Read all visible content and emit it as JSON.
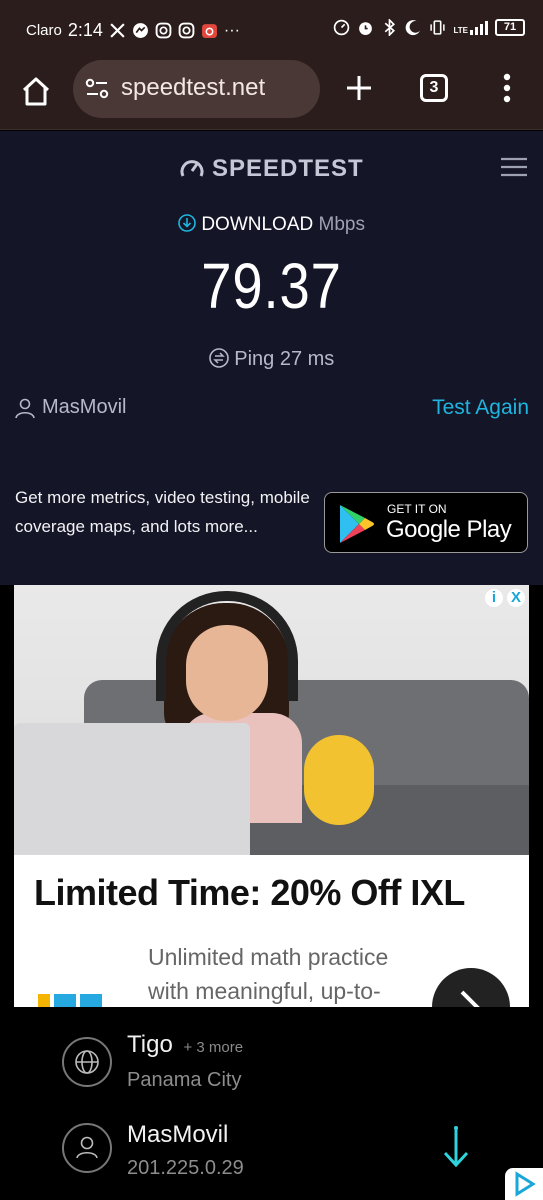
{
  "status_bar": {
    "carrier": "Claro",
    "time": "2:14",
    "overflow": "···",
    "network": "LTE",
    "battery": "71"
  },
  "browser": {
    "url": "speedtest.net",
    "tab_count": "3"
  },
  "speedtest": {
    "logo_text": "SPEEDTEST",
    "download_label": "DOWNLOAD",
    "download_unit": "Mbps",
    "download_value": "79.37",
    "ping_label": "Ping",
    "ping_value": "27",
    "ping_unit": "ms",
    "isp": "MasMovil",
    "test_again": "Test Again",
    "promo_text": "Get more metrics, video testing, mobile coverage maps, and lots more...",
    "store_small": "GET IT ON",
    "store_big": "Google Play"
  },
  "ad": {
    "title": "Limited Time: 20% Off IXL",
    "description": "Unlimited math practice with meaningful, up-to-",
    "logo": "IXL",
    "info_glyph": "i",
    "close_glyph": "X"
  },
  "servers": [
    {
      "name": "Tigo",
      "more": "+ 3 more",
      "location": "Panama City",
      "icon": "globe-icon"
    },
    {
      "name": "MasMovil",
      "more": "",
      "location": "201.225.0.29",
      "icon": "person-icon"
    }
  ],
  "colors": {
    "accent": "#1fb5e0",
    "speedtest_bg": "#141526",
    "browser_bg": "#2a1d1b"
  }
}
